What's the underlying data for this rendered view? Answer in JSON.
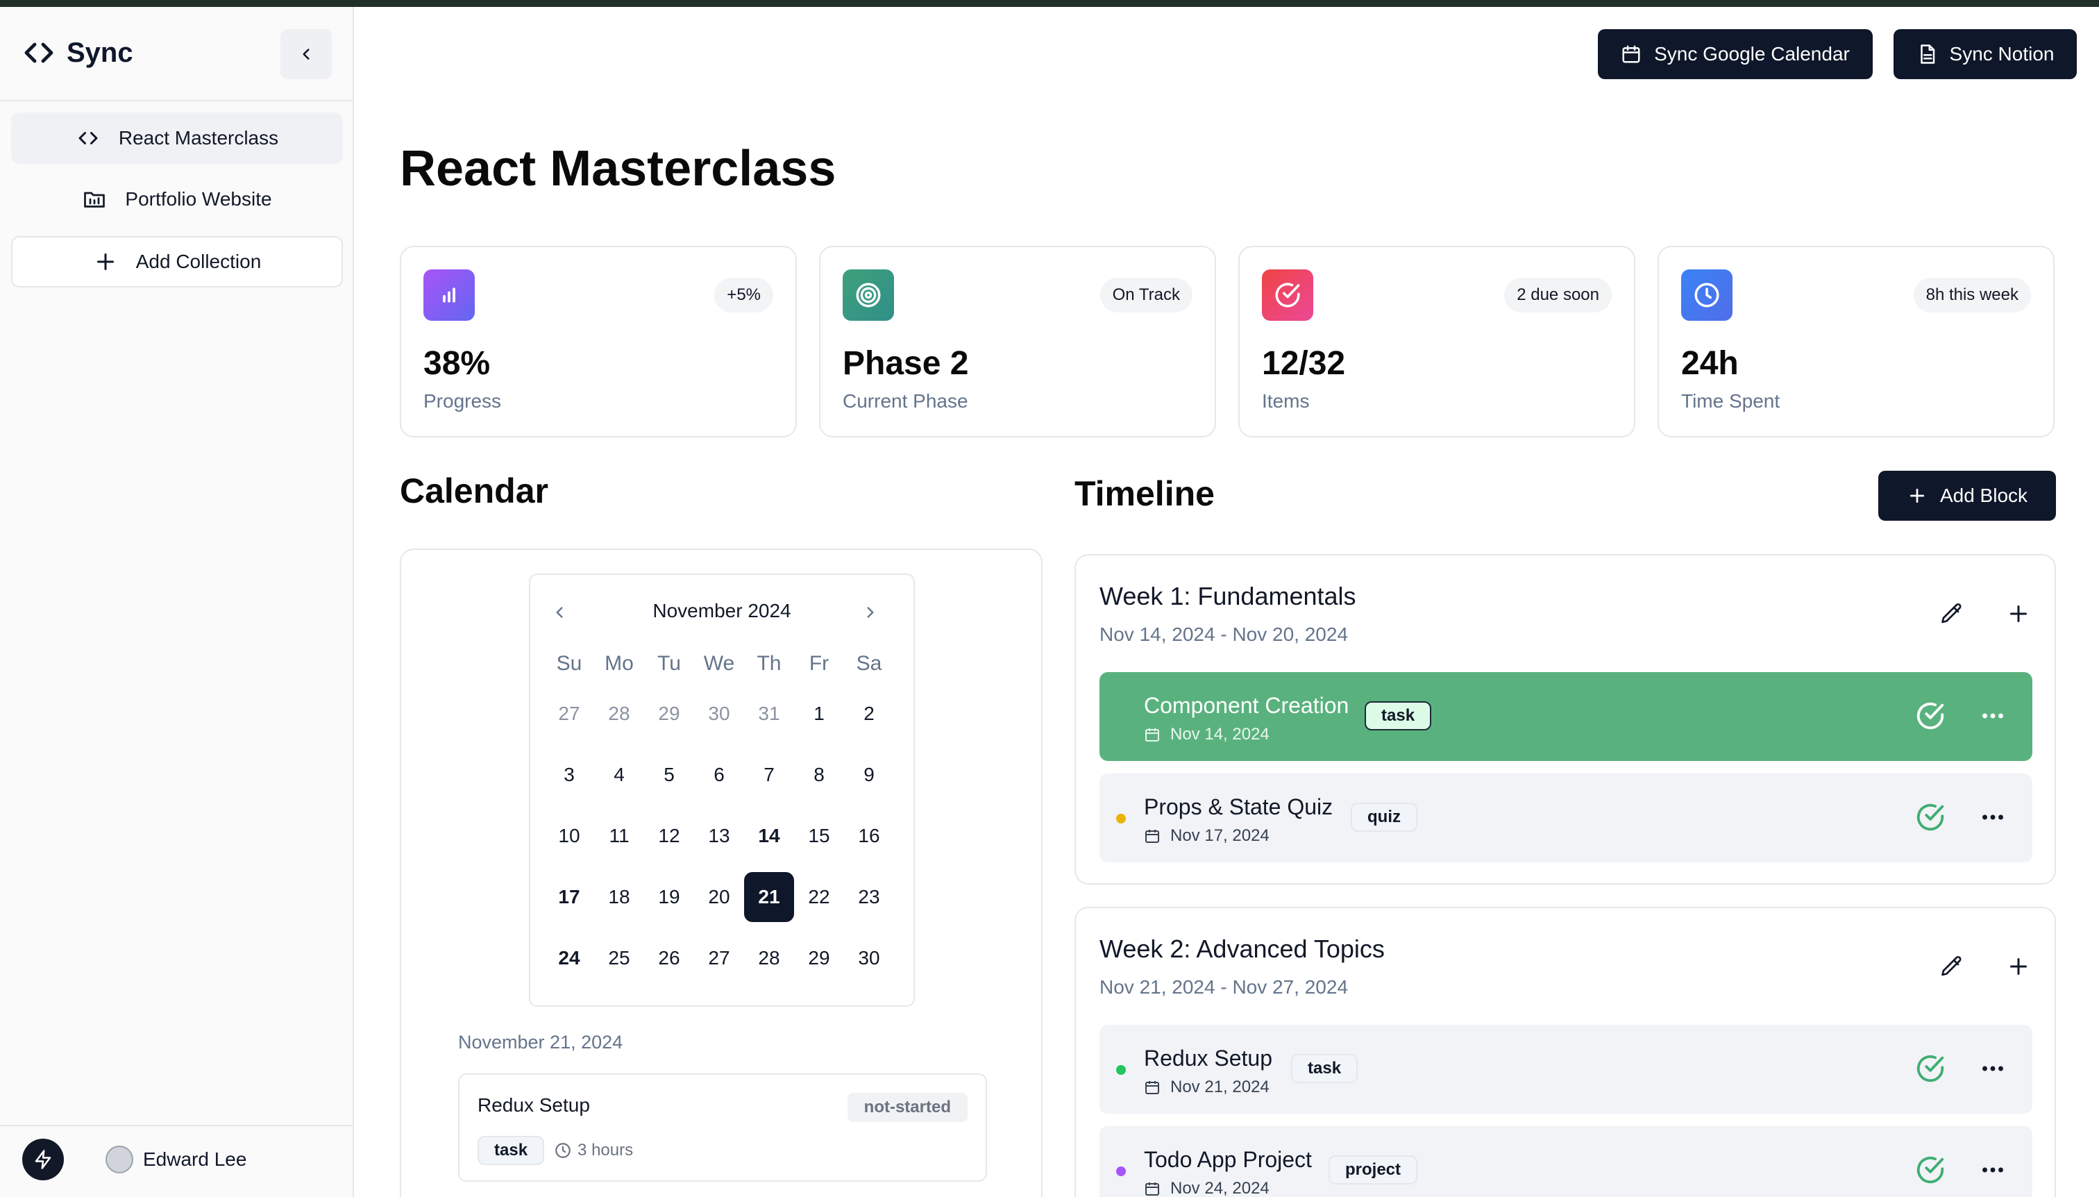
{
  "sidebar": {
    "brand": "Sync",
    "items": [
      {
        "label": "React Masterclass",
        "icon": "code-icon",
        "active": true
      },
      {
        "label": "Portfolio Website",
        "icon": "folder-icon",
        "active": false
      }
    ],
    "add_collection": "Add Collection",
    "user_name": "Edward Lee"
  },
  "header": {
    "sync_google": "Sync Google Calendar",
    "sync_notion": "Sync Notion"
  },
  "page": {
    "title": "React Masterclass"
  },
  "stats": [
    {
      "value": "38%",
      "label": "Progress",
      "badge": "+5%",
      "icon": "bar-chart-icon",
      "color": "#8b5cf6"
    },
    {
      "value": "Phase 2",
      "label": "Current Phase",
      "badge": "On Track",
      "icon": "target-icon",
      "color": "#3fa07a"
    },
    {
      "value": "12/32",
      "label": "Items",
      "badge": "2 due soon",
      "icon": "check-circle-icon",
      "color": "#e73c63"
    },
    {
      "value": "24h",
      "label": "Time Spent",
      "badge": "8h this week",
      "icon": "clock-icon",
      "color": "#3b7ee8"
    }
  ],
  "calendar": {
    "section_title": "Calendar",
    "month": "November 2024",
    "weekdays": [
      "Su",
      "Mo",
      "Tu",
      "We",
      "Th",
      "Fr",
      "Sa"
    ],
    "weeks": [
      [
        "27",
        "28",
        "29",
        "30",
        "31",
        "1",
        "2"
      ],
      [
        "3",
        "4",
        "5",
        "6",
        "7",
        "8",
        "9"
      ],
      [
        "10",
        "11",
        "12",
        "13",
        "14",
        "15",
        "16"
      ],
      [
        "17",
        "18",
        "19",
        "20",
        "21",
        "22",
        "23"
      ],
      [
        "24",
        "25",
        "26",
        "27",
        "28",
        "29",
        "30"
      ]
    ],
    "selected_day": "21",
    "event_days": [
      "14",
      "17",
      "24"
    ],
    "selected_date_label": "November 21, 2024",
    "event": {
      "title": "Redux Setup",
      "status": "not-started",
      "tag": "task",
      "duration": "3 hours"
    }
  },
  "timeline": {
    "section_title": "Timeline",
    "add_block": "Add Block",
    "weeks": [
      {
        "title": "Week 1: Fundamentals",
        "range": "Nov 14, 2024 - Nov 20, 2024",
        "blocks": [
          {
            "title": "Component Creation",
            "date": "Nov 14, 2024",
            "tag": "task",
            "completed": true,
            "dot_color": "#59b27e"
          },
          {
            "title": "Props & State Quiz",
            "date": "Nov 17, 2024",
            "tag": "quiz",
            "completed": false,
            "dot_color": "#eab308"
          }
        ]
      },
      {
        "title": "Week 2: Advanced Topics",
        "range": "Nov 21, 2024 - Nov 27, 2024",
        "blocks": [
          {
            "title": "Redux Setup",
            "date": "Nov 21, 2024",
            "tag": "task",
            "completed": false,
            "dot_color": "#22c55e"
          },
          {
            "title": "Todo App Project",
            "date": "Nov 24, 2024",
            "tag": "project",
            "completed": false,
            "dot_color": "#a855f7"
          }
        ]
      }
    ]
  }
}
